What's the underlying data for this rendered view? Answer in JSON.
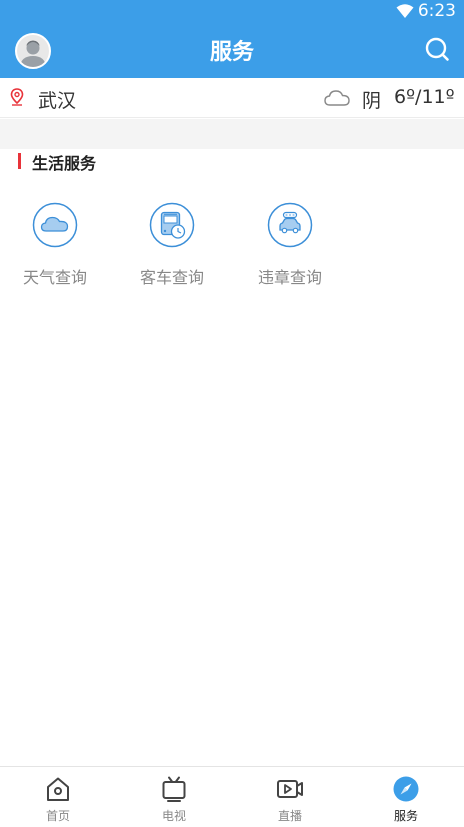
{
  "status_bar": {
    "time": "6:23"
  },
  "header": {
    "title": "服务"
  },
  "location": {
    "city": "武汉",
    "condition": "阴",
    "temperature": "6º/11º"
  },
  "section": {
    "title": "生活服务"
  },
  "services": [
    {
      "label": "天气查询",
      "icon": "cloud-icon"
    },
    {
      "label": "客车查询",
      "icon": "bus-schedule-icon"
    },
    {
      "label": "违章查询",
      "icon": "car-violation-icon"
    }
  ],
  "tabs": [
    {
      "label": "首页",
      "icon": "home-icon",
      "active": false
    },
    {
      "label": "电视",
      "icon": "tv-icon",
      "active": false
    },
    {
      "label": "直播",
      "icon": "live-video-icon",
      "active": false
    },
    {
      "label": "服务",
      "icon": "compass-icon",
      "active": true
    }
  ],
  "colors": {
    "primary": "#3c9ee8",
    "accent_red": "#e8333a",
    "icon_fill": "#a6cdf0"
  }
}
